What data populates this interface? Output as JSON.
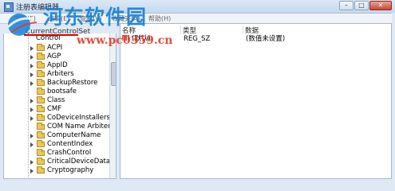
{
  "window": {
    "title": "注册表编辑器",
    "minimize_glyph": "–",
    "maximize_glyph": "□",
    "close_glyph": "✕"
  },
  "menu": {
    "items": [
      "文件(F)",
      "编辑(E)",
      "查看(V)",
      "收藏夹(A)",
      "帮助(H)"
    ]
  },
  "watermark": {
    "title": "河东软件园",
    "url": "www.pc0359.cn"
  },
  "tree": {
    "parent": "CurrentControlSet",
    "current": "Control",
    "items": [
      "ACPI",
      "AGP",
      "AppID",
      "Arbiters",
      "BackupRestore",
      "bootsafe",
      "Class",
      "CMF",
      "CoDeviceInstallers",
      "COM Name Arbiter",
      "ComputerName",
      "ContentIndex",
      "CrashControl",
      "CriticalDeviceDataba",
      "Cryptography"
    ]
  },
  "values": {
    "columns": [
      "名称",
      "类型",
      "数据"
    ],
    "rows": [
      {
        "name": "(默认)",
        "type": "REG_SZ",
        "data": "(数值未设置)"
      }
    ]
  },
  "icons": {
    "folder": "folder-icon",
    "expand": "expand-arrow-icon",
    "string_value": "string-value-icon"
  },
  "colors": {
    "folder": "#e9c75a",
    "watermark_blue": "#1580d3",
    "watermark_red": "#e03c28",
    "highlight_underline": "#d10000"
  }
}
